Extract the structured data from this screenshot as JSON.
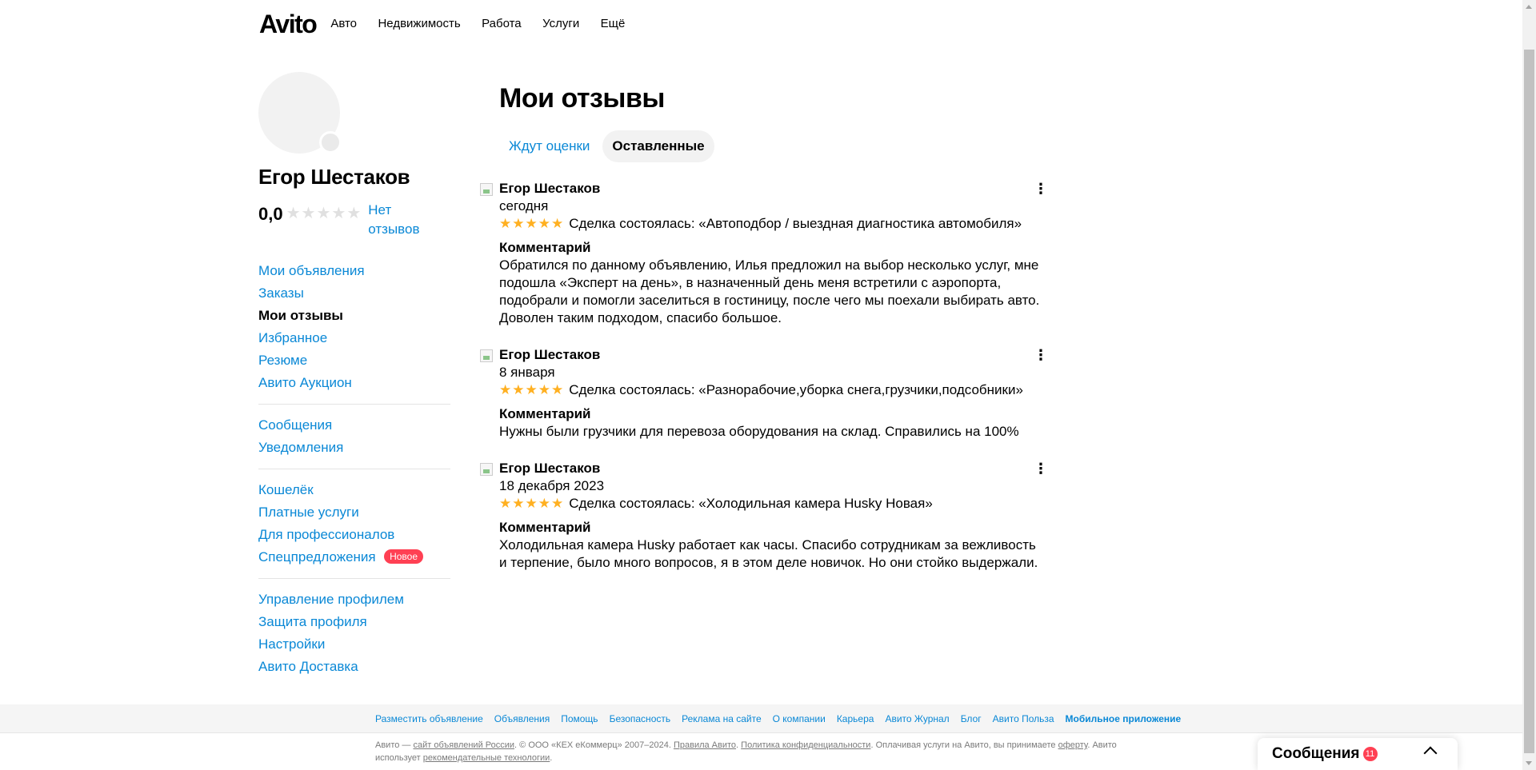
{
  "header": {
    "logo": "Avito",
    "nav": [
      "Авто",
      "Недвижимость",
      "Работа",
      "Услуги",
      "Ещё"
    ]
  },
  "profile": {
    "name": "Егор Шестаков",
    "rating": "0,0",
    "no_reviews": "Нет отзывов"
  },
  "sidebar": {
    "groups": [
      [
        "Мои объявления",
        "Заказы",
        "Мои отзывы",
        "Избранное",
        "Резюме",
        "Авито Аукцион"
      ],
      [
        "Сообщения",
        "Уведомления"
      ],
      [
        "Кошелёк",
        "Платные услуги",
        "Для профессионалов",
        "Спецпредложения"
      ],
      [
        "Управление профилем",
        "Защита профиля",
        "Настройки",
        "Авито Доставка"
      ]
    ],
    "badge_new": "Новое"
  },
  "main": {
    "title": "Мои отзывы",
    "tabs": [
      "Ждут оценки",
      "Оставленные"
    ],
    "reviews": [
      {
        "author": "Егор Шестаков",
        "date": "сегодня",
        "stars": "★★★★★",
        "deal": "Сделка состоялась: «Автоподбор / выездная диагностика автомобиля»",
        "comment_title": "Комментарий",
        "comment": "Обратился по данному объявлению, Илья предложил на выбор несколько услуг, мне подошла «Эксперт на день», в назначенный день меня встретили с аэропорта, подобрали и помогли заселиться в гостиницу, после чего мы поехали выбирать авто. Доволен таким подходом, спасибо большое."
      },
      {
        "author": "Егор Шестаков",
        "date": "8 января",
        "stars": "★★★★★",
        "deal": "Сделка состоялась: «Разнорабочие,уборка снега,грузчики,подсобники»",
        "comment_title": "Комментарий",
        "comment": "Нужны были грузчики для перевоза оборудования на склад. Справились на 100%"
      },
      {
        "author": "Егор Шестаков",
        "date": "18 декабря 2023",
        "stars": "★★★★★",
        "deal": "Сделка состоялась: «Холодильная камера Husky Новая»",
        "comment_title": "Комментарий",
        "comment": "Холодильная камера Husky работает как часы. Спасибо сотрудникам за вежливость и терпение, было много вопросов, я в этом деле новичок. Но они стойко выдержали."
      }
    ]
  },
  "footer": {
    "links": [
      "Разместить объявление",
      "Объявления",
      "Помощь",
      "Безопасность",
      "Реклама на сайте",
      "О компании",
      "Карьера",
      "Авито Журнал",
      "Блог",
      "Авито Польза",
      "Мобильное приложение"
    ],
    "legal_1": "Авито — ",
    "legal_link_1": "сайт объявлений России",
    "legal_2": ". © ООО «КЕХ еКоммерц» 2007–2024. ",
    "legal_link_2": "Правила Авито",
    "legal_3": ". ",
    "legal_link_3": "Политика конфиденциальности",
    "legal_4": ". Оплачивая услуги на Авито, вы принимаете ",
    "legal_link_4": "оферту",
    "legal_5": ". Авито использует ",
    "legal_link_5": "рекомендательные технологии",
    "legal_6": "."
  },
  "messenger": {
    "title": "Сообщения",
    "count": "11"
  },
  "colors": {
    "link": "#0a88d6",
    "star": "#ffb021",
    "badge": "#ff4053"
  }
}
